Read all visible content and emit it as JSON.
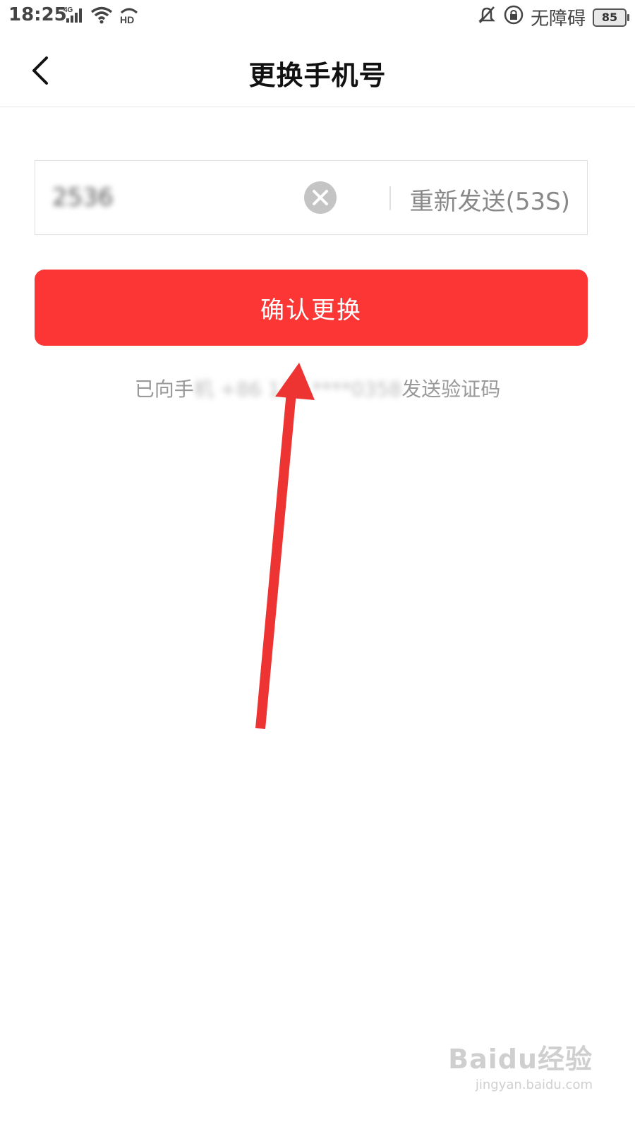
{
  "status_bar": {
    "time": "18:25",
    "network": "4G",
    "hd_badge": "HD",
    "accessibility_label": "无障碍",
    "battery": "85",
    "icons": [
      "signal-icon",
      "wifi-icon",
      "hd-icon",
      "silent-bell-icon",
      "lock-icon",
      "battery-icon"
    ]
  },
  "nav": {
    "title": "更换手机号",
    "back_icon": "chevron-left-icon"
  },
  "code_field": {
    "value": "2536",
    "clear_icon": "clear-circle-icon",
    "resend_label": "重新发送(53S)"
  },
  "confirm": {
    "label": "确认更换",
    "color": "#fc3535"
  },
  "hint": {
    "prefix": "已向手",
    "masked_middle": "机 +86 138 ****0358",
    "suffix": "发送验证码"
  },
  "annotation": {
    "arrow_color": "#ee3333"
  },
  "watermark": {
    "brand": "Baidu经验",
    "url": "jingyan.baidu.com"
  }
}
